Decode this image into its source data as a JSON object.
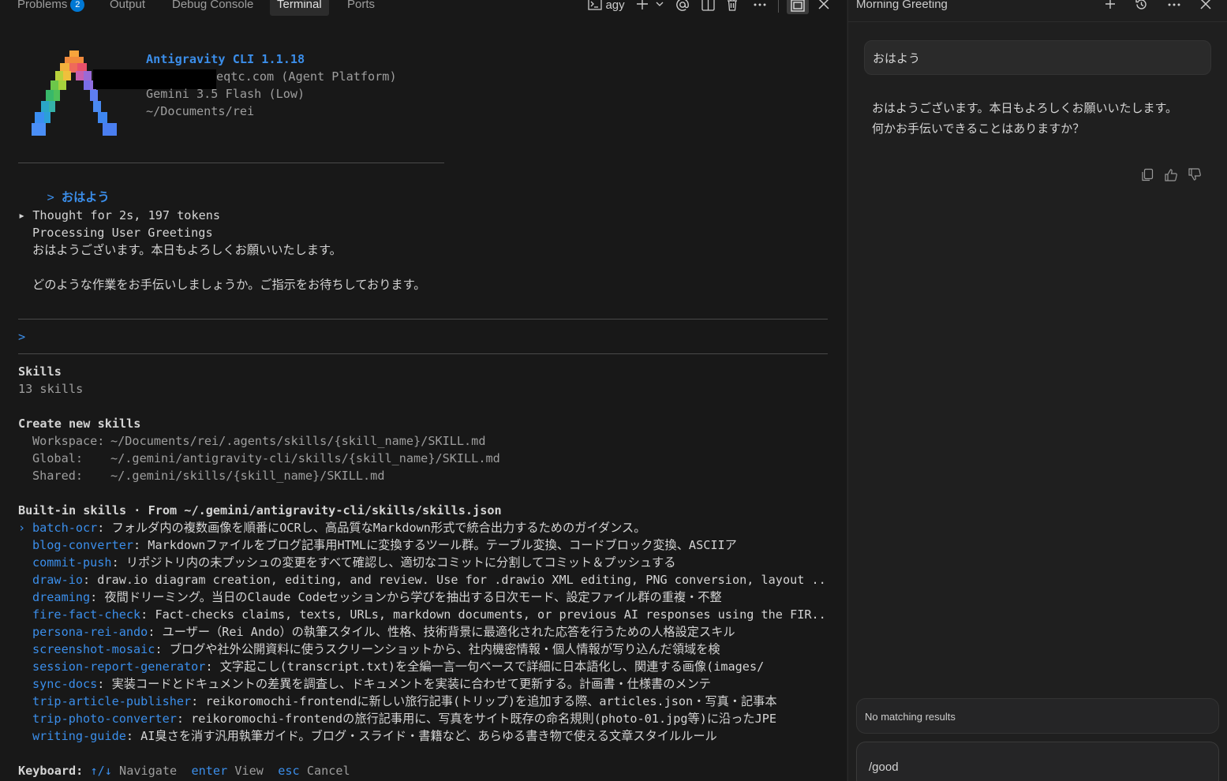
{
  "panel_tabs": {
    "problems": "Problems",
    "problems_count": "2",
    "output": "Output",
    "debug_console": "Debug Console",
    "terminal": "Terminal",
    "ports": "Ports"
  },
  "terminal_toolbar": {
    "profile_name": "agy",
    "icons": [
      "terminal-icon",
      "plus-icon",
      "chevron-down-icon",
      "at-icon",
      "split-icon",
      "trash-icon",
      "more-icon",
      "maximize-icon",
      "close-icon"
    ]
  },
  "header_info": {
    "app_name": "Antigravity CLI 1.1.18",
    "account_suffix": "eqtc.com (Agent Platform)",
    "model": "Gemini 3.5 Flash (Low)",
    "cwd": "~/Documents/rei"
  },
  "conversation": {
    "prompt_symbol": ">",
    "user_message": "おはよう",
    "thought": "▸ Thought for 2s, 197 tokens",
    "task": "Processing User Greetings",
    "reply_1": "おはようございます。本日もよろしくお願いいたします。",
    "reply_2": "どのような作業をお手伝いしましょうか。ご指示をお待ちしております。"
  },
  "input_prompt": ">",
  "skills": {
    "title": "Skills",
    "count": "13 skills",
    "create_title": "Create new skills",
    "workspace_label": "Workspace:",
    "workspace_path": "~/Documents/rei/.agents/skills/{skill_name}/SKILL.md",
    "global_label": "Global:",
    "global_path": "~/.gemini/antigravity-cli/skills/{skill_name}/SKILL.md",
    "shared_label": "Shared:",
    "shared_path": "~/.gemini/skills/{skill_name}/SKILL.md",
    "builtin_title": "Built-in skills · From ~/.gemini/antigravity-cli/skills/skills.json",
    "selector": "›",
    "items": [
      {
        "name": "batch-ocr",
        "desc": ": フォルダ内の複数画像を順番にOCRし、高品質なMarkdown形式で統合出力するためのガイダンス。"
      },
      {
        "name": "blog-converter",
        "desc": ": Markdownファイルをブログ記事用HTMLに変換するツール群。テーブル変換、コードブロック変換、ASCIIア"
      },
      {
        "name": "commit-push",
        "desc": ": リポジトリ内の未プッシュの変更をすべて確認し、適切なコミットに分割してコミット＆プッシュする"
      },
      {
        "name": "draw-io",
        "desc": ": draw.io diagram creation, editing, and review. Use for .drawio XML editing, PNG conversion, layout ..."
      },
      {
        "name": "dreaming",
        "desc": ": 夜間ドリーミング。当日のClaude Codeセッションから学びを抽出する日次モード、設定ファイル群の重複・不整"
      },
      {
        "name": "fire-fact-check",
        "desc": ": Fact-checks claims, texts, URLs, markdown documents, or previous AI responses using the FIR..."
      },
      {
        "name": "persona-rei-ando",
        "desc": ": ユーザー（Rei Ando）の執筆スタイル、性格、技術背景に最適化された応答を行うための人格設定スキル"
      },
      {
        "name": "screenshot-mosaic",
        "desc": ": ブログや社外公開資料に使うスクリーンショットから、社内機密情報・個人情報が写り込んだ領域を検"
      },
      {
        "name": "session-report-generator",
        "desc": ": 文字起こし(transcript.txt)を全編一言一句ベースで詳細に日本語化し、関連する画像(images/"
      },
      {
        "name": "sync-docs",
        "desc": ": 実装コードとドキュメントの差異を調査し、ドキュメントを実装に合わせて更新する。計画書・仕様書のメンテ"
      },
      {
        "name": "trip-article-publisher",
        "desc": ": reikoromochi-frontendに新しい旅行記事(トリップ)を追加する際、articles.json・写真・記事本"
      },
      {
        "name": "trip-photo-converter",
        "desc": ": reikoromochi-frontendの旅行記事用に、写真をサイト既存の命名規則(photo-01.jpg等)に沿ったJPE"
      },
      {
        "name": "writing-guide",
        "desc": ": AI臭さを消す汎用執筆ガイド。ブログ・スライド・書籍など、あらゆる書き物で使える文章スタイルルール"
      }
    ]
  },
  "keyboard": {
    "label": "Keyboard:",
    "nav_keys": "↑/↓",
    "nav_action": "Navigate",
    "enter_key": "enter",
    "enter_action": "View",
    "esc_key": "esc",
    "esc_action": "Cancel"
  },
  "chat": {
    "title": "Morning Greeting",
    "header_icons": [
      "plus-icon",
      "history-icon",
      "more-icon",
      "close-icon"
    ],
    "user_message": "おはよう",
    "assistant_line_1": "おはようございます。本日もよろしくお願いいたします。",
    "assistant_line_2": "何かお手伝いできることはありますか？",
    "no_match": "No matching results",
    "input_value": "/good"
  },
  "colors": {
    "background": "#181818",
    "accent_blue": "#3b8eea",
    "badge": "#0078d4"
  }
}
